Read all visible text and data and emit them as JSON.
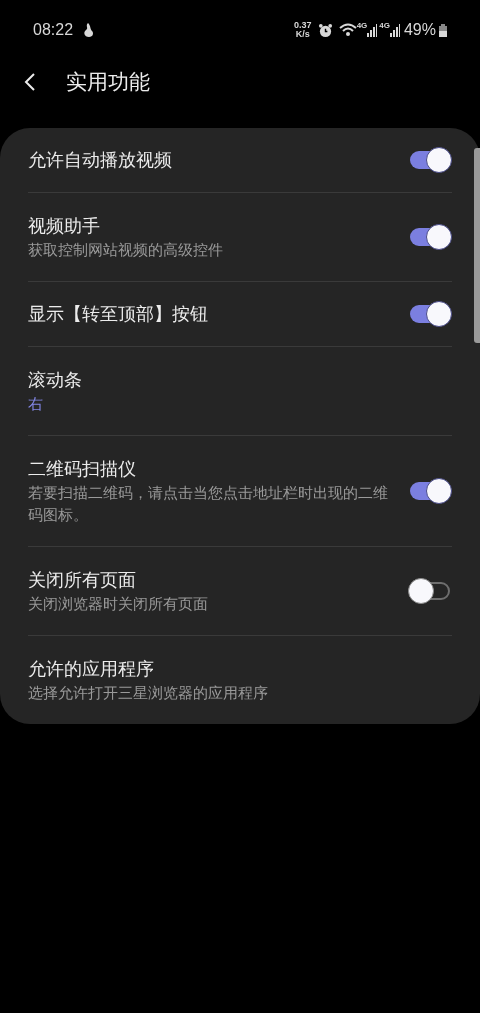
{
  "status_bar": {
    "time": "08:22",
    "speed": "0.37",
    "speed_unit": "K/s",
    "network_1": "4G",
    "network_2": "4G",
    "battery": "49%"
  },
  "header": {
    "title": "实用功能"
  },
  "settings": [
    {
      "kind": "toggle",
      "title": "允许自动播放视频",
      "on": true
    },
    {
      "kind": "toggle",
      "title": "视频助手",
      "subtitle": "获取控制网站视频的高级控件",
      "on": true
    },
    {
      "kind": "toggle",
      "title": "显示【转至顶部】按钮",
      "on": true
    },
    {
      "kind": "value",
      "title": "滚动条",
      "value": "右"
    },
    {
      "kind": "toggle",
      "title": "二维码扫描仪",
      "subtitle": "若要扫描二维码，请点击当您点击地址栏时出现的二维码图标。",
      "on": true
    },
    {
      "kind": "toggle",
      "title": "关闭所有页面",
      "subtitle": "关闭浏览器时关闭所有页面",
      "on": false
    },
    {
      "kind": "link",
      "title": "允许的应用程序",
      "subtitle": "选择允许打开三星浏览器的应用程序"
    }
  ]
}
